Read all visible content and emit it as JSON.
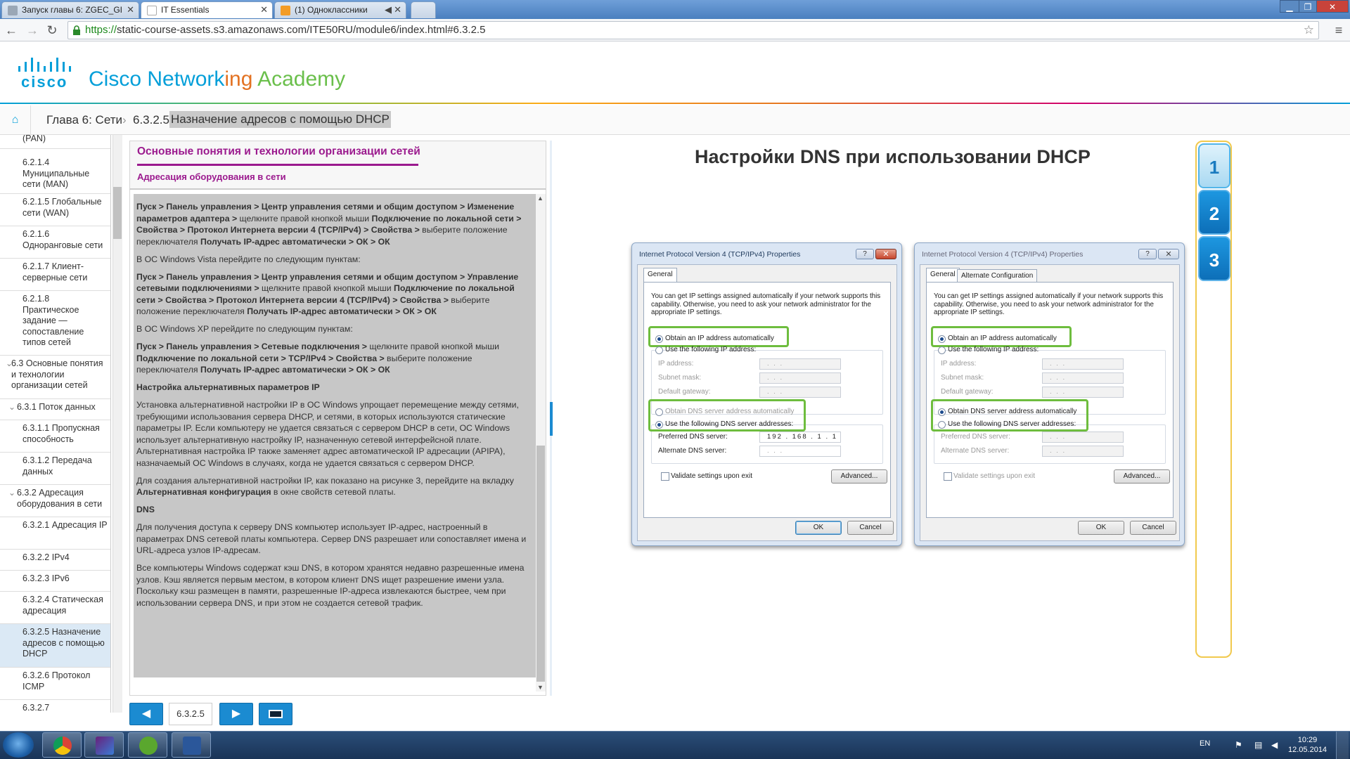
{
  "browser": {
    "tabs": [
      {
        "label": "Запуск главы 6: ZGEC_GI"
      },
      {
        "label": "IT Essentials"
      },
      {
        "label": "(1) Одноклассники"
      }
    ],
    "url_scheme": "https://",
    "url_rest": "static-course-assets.s3.amazonaws.com/ITE50RU/module6/index.html#6.3.2.5"
  },
  "brand": {
    "cisco": "cisco",
    "academy_pre": "Cisco Network",
    "academy_mid": "ing",
    "academy_post": "Academy"
  },
  "breadcrumb": {
    "chapter": "Глава 6: Сети",
    "sep1": "›",
    "section_num": "6.3.2.5",
    "section_title": "Назначение адресов с помощью DHCP"
  },
  "sidebar": {
    "items": [
      {
        "label": "(PAN)"
      },
      {
        "label": "6.2.1.4 Муниципальные сети (MAN)"
      },
      {
        "label": "6.2.1.5 Глобальные сети (WAN)"
      },
      {
        "label": "6.2.1.6 Одноранговые сети"
      },
      {
        "label": "6.2.1.7 Клиент-серверные сети"
      },
      {
        "label": "6.2.1.8 Практическое задание — сопоставление типов сетей"
      },
      {
        "label": "6.3 Основные понятия и технологии организации сетей"
      },
      {
        "label": "6.3.1 Поток данных"
      },
      {
        "label": "6.3.1.1 Пропускная способность"
      },
      {
        "label": "6.3.1.2 Передача данных"
      },
      {
        "label": "6.3.2 Адресация оборудования в сети"
      },
      {
        "label": "6.3.2.1 Адресация IP"
      },
      {
        "label": "6.3.2.2 IPv4"
      },
      {
        "label": "6.3.2.3 IPv6"
      },
      {
        "label": "6.3.2.4 Статическая адресация"
      },
      {
        "label": "6.3.2.5 Назначение адресов с помощью DHCP"
      },
      {
        "label": "6.3.2.6 Протокол ICMP"
      },
      {
        "label": "6.3.2.7"
      }
    ],
    "chevron": "⌄"
  },
  "panel": {
    "title": "Основные понятия и технологии организации сетей",
    "subtitle": "Адресация оборудования в сети",
    "p1_b1": "Пуск > Панель управления > Центр управления сетями и общим доступом > Изменение параметров адаптера >",
    "p1_t1": " щелкните правой кнопкой мыши ",
    "p1_b2": "Подключение по локальной сети > Свойства > Протокол Интернета версии 4 (TCP/IPv4) > Свойства >",
    "p1_t2": " выберите положение переключателя ",
    "p1_b3": "Получать IP-адрес автоматически > ОК > ОК",
    "p2": "В ОС Windows Vista перейдите по следующим пунктам:",
    "p3_b1": "Пуск > Панель управления > Центр управления сетями и общим доступом > Управление сетевыми подключениями >",
    "p3_t1": " щелкните правой кнопкой мыши ",
    "p3_b2": "Подключение по локальной сети > Свойства > Протокол Интернета версии 4 (TCP/IPv4) > Свойства >",
    "p3_t2": " выберите положение переключателя ",
    "p3_b3": "Получать IP-адрес автоматически > ОК > ОК",
    "p4": "В ОС Windows XP перейдите по следующим пунктам:",
    "p5_b1": "Пуск > Панель управления > Сетевые подключения >",
    "p5_t1": " щелкните правой кнопкой мыши ",
    "p5_b2": "Подключение по локальной сети > TCP/IPv4 > Свойства >",
    "p5_t2": " выберите положение переключателя ",
    "p5_b3": "Получать IP-адрес автоматически > ОК > ОК",
    "h_alt": "Настройка альтернативных параметров IP",
    "p6": "Установка альтернативной настройки IP в ОС Windows упрощает перемещение между сетями, требующими использования сервера DHCP, и сетями, в которых используются статические параметры IP. Если компьютеру не удается связаться с сервером DHCP в сети, ОС Windows использует альтернативную настройку IP, назначенную сетевой интерфейсной плате. Альтернативная настройка IP также заменяет адрес автоматической IP адресации (APIPA), назначаемый ОС Windows в случаях, когда не удается связаться с сервером DHCP.",
    "p7_t1": "Для создания альтернативной настройки IP, как показано на рисунке 3, перейдите на вкладку ",
    "p7_b1": "Альтернативная конфигурация",
    "p7_t2": " в окне свойств сетевой платы.",
    "h_dns": "DNS",
    "p8": "Для получения доступа к серверу DNS компьютер использует IP-адрес, настроенный в параметрах DNS сетевой платы компьютера. Сервер DNS разрешает или сопоставляет имена и URL-адреса узлов IP-адресам.",
    "p9": "Все компьютеры Windows содержат кэш DNS, в котором хранятся недавно разрешенные имена узлов. Кэш является первым местом, в котором клиент DNS ищет разрешение имени узла. Поскольку кэш размещен в памяти, разрешенные IP-адреса извлекаются быстрее, чем при использовании сервера DNS, и при этом не создается сетевой трафик."
  },
  "nav": {
    "page": "6.3.2.5"
  },
  "figure": {
    "title": "Настройки DNS при использовании DHCP",
    "tabs": [
      "1",
      "2",
      "3"
    ]
  },
  "dialog_left": {
    "title": "Internet Protocol Version 4 (TCP/IPv4) Properties",
    "q": "?",
    "close": "✕",
    "tab_general": "General",
    "desc": "You can get IP settings assigned automatically if your network supports this capability. Otherwise, you need to ask your network administrator for the appropriate IP settings.",
    "obtain_ip": "Obtain an IP address automatically",
    "use_ip": "Use the following IP address:",
    "ip_label": "IP address:",
    "mask_label": "Subnet mask:",
    "gw_label": "Default gateway:",
    "obtain_dns": "Obtain DNS server address automatically",
    "use_dns": "Use the following DNS server addresses:",
    "pref_dns": "Preferred DNS server:",
    "alt_dns": "Alternate DNS server:",
    "pref_dns_value": "192 . 168 .  1  .  1",
    "empty_ip": ".    .    .",
    "validate": "Validate settings upon exit",
    "advanced": "Advanced...",
    "ok": "OK",
    "cancel": "Cancel"
  },
  "dialog_right": {
    "title": "Internet Protocol Version 4 (TCP/IPv4) Properties",
    "q": "?",
    "close": "✕",
    "tab_general": "General",
    "tab_alt": "Alternate Configuration",
    "desc": "You can get IP settings assigned automatically if your network supports this capability. Otherwise, you need to ask your network administrator for the appropriate IP settings.",
    "obtain_ip": "Obtain an IP address automatically",
    "use_ip": "Use the following IP address:",
    "ip_label": "IP address:",
    "mask_label": "Subnet mask:",
    "gw_label": "Default gateway:",
    "obtain_dns": "Obtain DNS server address automatically",
    "use_dns": "Use the following DNS server addresses:",
    "pref_dns": "Preferred DNS server:",
    "alt_dns": "Alternate DNS server:",
    "empty_ip": ".    .    .",
    "validate": "Validate settings upon exit",
    "advanced": "Advanced...",
    "ok": "OK",
    "cancel": "Cancel"
  },
  "taskbar": {
    "lang": "EN",
    "time": "10:29",
    "date": "12.05.2014"
  },
  "colors": {
    "cisco_blue": "#049fd9",
    "purple": "#9b1a8e",
    "highlight_green": "#6ebd3e",
    "nav_blue": "#1b8bd1"
  }
}
